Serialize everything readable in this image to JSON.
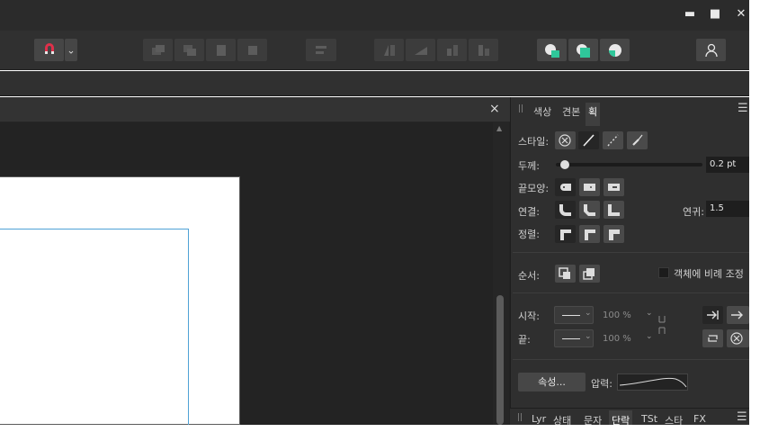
{
  "window": {
    "minimize_glyph": "▬",
    "maximize_glyph": "■",
    "close_glyph": "✕"
  },
  "toolbar": {
    "snapping_icon": "magnet-icon",
    "snapping_dropdown_glyph": "⌄",
    "accent_colors": {
      "magnet": "#e0304a",
      "boolean": "#2fc79a"
    }
  },
  "document": {
    "close_glyph": "×",
    "scroll_up_glyph": "▲"
  },
  "panel": {
    "tabs": [
      "색상",
      "견본",
      "획"
    ],
    "active_tab": "획",
    "menu_glyph": "☰",
    "stroke": {
      "style_label": "스타일:",
      "width_label": "두께:",
      "width_value": "0.2 pt",
      "width_fraction": 0.03,
      "cap_label": "끝모양:",
      "join_label": "연결:",
      "miter_label": "연귀:",
      "miter_value": "1.5",
      "align_label": "정렬:"
    },
    "order": {
      "label": "순서:",
      "scale_label": "객체에 비례 조정"
    },
    "arrows": {
      "start_label": "시작:",
      "end_label": "끝:",
      "start_pct": "100 %",
      "end_pct": "100 %"
    },
    "pressure": {
      "properties_button": "속성...",
      "pressure_label": "압력:"
    },
    "bottom_tabs": [
      "Lyr",
      "상태",
      "문자",
      "단락",
      "TSt",
      "스타",
      "FX"
    ],
    "bottom_active": "단락"
  }
}
